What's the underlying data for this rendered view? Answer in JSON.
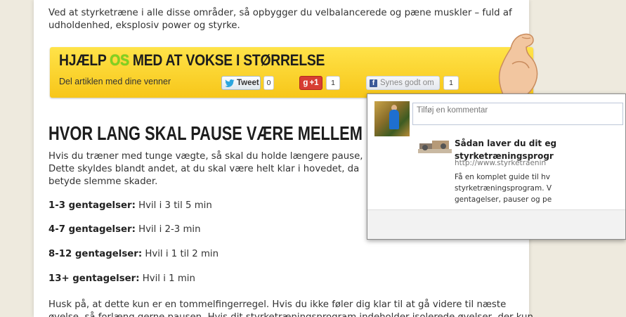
{
  "intro_text": "Ved at styrketræne i alle disse områder, så opbygger du velbalancerede og pæne muskler – fuld af udholdenhed, eksplosiv power og styrke.",
  "banner": {
    "title_before": "HJÆLP ",
    "title_os": "OS",
    "title_after": " MED AT VOKSE I STØRRELSE",
    "subtitle": "Del artiklen med dine venner",
    "tweet_label": "Tweet",
    "tweet_count": "0",
    "gplus_label": "+1",
    "gplus_count": "1",
    "fb_label": "Synes godt om",
    "fb_count": "1"
  },
  "heading": "HVOR LANG SKAL PAUSE VÆRE MELLEM HVERT SÆ",
  "paragraph": {
    "line1": "Hvis du træner med tunge vægte, så skal du holde længere pause,",
    "line2": "Dette skyldes blandt andet, at du skal være helt klar i hovedet, da",
    "line3": "betyde slemme skader."
  },
  "reps": [
    {
      "label": "1-3 gentagelser:",
      "value": " Hvil i 3 til 5 min"
    },
    {
      "label": "4-7 gentagelser:",
      "value": " Hvil i 2-3 min"
    },
    {
      "label": "8-12 gentagelser:",
      "value": " Hvil i 1 til 2 min"
    },
    {
      "label": "13+ gentagelser:",
      "value": " Hvil i 1 min"
    }
  ],
  "closing": {
    "line1": "Husk på, at dette kun er en tommelfingerregel. Hvis du ikke føler dig klar til at gå videre til næste",
    "line2": "øvelse, så forlæng gerne pausen. Hvis dit styrketræningsprogram indeholder isolerede øvelser, der kun"
  },
  "popup": {
    "comment_placeholder": "Tilføj en kommentar",
    "link_title_1": "Sådan laver du dit eg",
    "link_title_2": "styrketræningsprogr",
    "link_url": "http://www.styrketraenin",
    "desc_1": "Få en komplet guide til hv",
    "desc_2": "styrketræningsprogram. V",
    "desc_3": "gentagelser, pauser og pe"
  },
  "colors": {
    "background": "#eeeade",
    "banner_yellow": "#f7c619",
    "os_green": "#7ed321",
    "fb_blue": "#3b5998",
    "gplus_red": "#d73d32"
  }
}
